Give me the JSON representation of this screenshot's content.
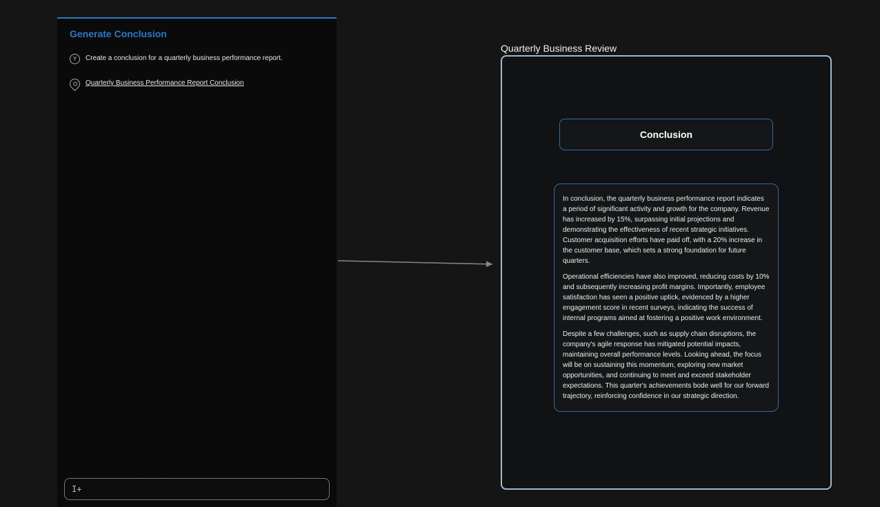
{
  "left": {
    "title": "Generate Conclusion",
    "user_msg": "Create a conclusion for a quarterly business performance report.",
    "assistant_msg": "Quarterly Business Performance Report Conclusion",
    "input_placeholder": "I+"
  },
  "right": {
    "doc_title": "Quarterly Business Review",
    "heading": "Conclusion",
    "p1": "In conclusion, the quarterly business performance report indicates a period of significant activity and growth for the company. Revenue has increased by 15%, surpassing initial projections and demonstrating the effectiveness of recent strategic initiatives. Customer acquisition efforts have paid off, with a 20% increase in the customer base, which sets a strong foundation for future quarters.",
    "p2": "Operational efficiencies have also improved, reducing costs by 10% and subsequently increasing profit margins. Importantly, employee satisfaction has seen a positive uptick, evidenced by a higher engagement score in recent surveys, indicating the success of internal programs aimed at fostering a positive work environment.",
    "p3": "Despite a few challenges, such as supply chain disruptions, the company's agile response has mitigated potential impacts, maintaining overall performance levels. Looking ahead, the focus will be on sustaining this momentum, exploring new market opportunities, and continuing to meet and exceed stakeholder expectations. This quarter's achievements bode well for our forward trajectory, reinforcing confidence in our strategic direction."
  }
}
